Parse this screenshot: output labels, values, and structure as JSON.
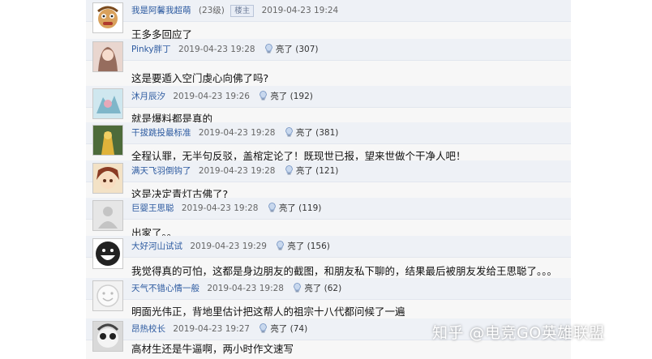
{
  "comments": [
    {
      "username": "我是阿馨我超萌",
      "level": "(23级)",
      "badge": "楼主",
      "time": "2019-04-23 19:24",
      "text": "王多多回应了",
      "likes": ""
    },
    {
      "username": "Pinky胖丁",
      "time": "2019-04-23 19:28",
      "like_label": "亮了",
      "likes": "(307)",
      "text": "这是要遁入空门虔心向佛了吗?"
    },
    {
      "username": "沐月辰汐",
      "time": "2019-04-23 19:26",
      "like_label": "亮了",
      "likes": "(192)",
      "text": "就是爆料都是真的"
    },
    {
      "username": "干拔跳投最标准",
      "time": "2019-04-23 19:28",
      "like_label": "亮了",
      "likes": "(381)",
      "text": "全程认罪，无半句反驳，盖棺定论了！既现世已报，望来世做个干净人吧！"
    },
    {
      "username": "满天飞羽倒钩了",
      "time": "2019-04-23 19:28",
      "like_label": "亮了",
      "likes": "(121)",
      "text": "这是决定青灯古佛了?"
    },
    {
      "username": "巨婴王思聪",
      "time": "2019-04-23 19:28",
      "like_label": "亮了",
      "likes": "(119)",
      "text": "出家了。。"
    },
    {
      "username": "大好河山试试",
      "time": "2019-04-23 19:29",
      "like_label": "亮了",
      "likes": "(156)",
      "text": "我觉得真的可怕，这都是身边朋友的截图，和朋友私下聊的，结果最后被朋友发给王思聪了。。。"
    },
    {
      "username": "天气不错心情一般",
      "time": "2019-04-23 19:28",
      "like_label": "亮了",
      "likes": "(62)",
      "text": "明面光伟正，背地里估计把这帮人的祖宗十八代都问候了一遍"
    },
    {
      "username": "昂热校长",
      "time": "2019-04-23 19:27",
      "like_label": "亮了",
      "likes": "(74)",
      "text": "高材生还是牛逼啊，两小时作文速写"
    }
  ],
  "watermark": "知乎 @电竞GO英雄联盟",
  "colors": {
    "username": "#2c5aa0",
    "header_bg": "#eef1f6",
    "panel_bg": "#f7f7f7"
  },
  "icons": {
    "like": "lightbulb-icon"
  }
}
